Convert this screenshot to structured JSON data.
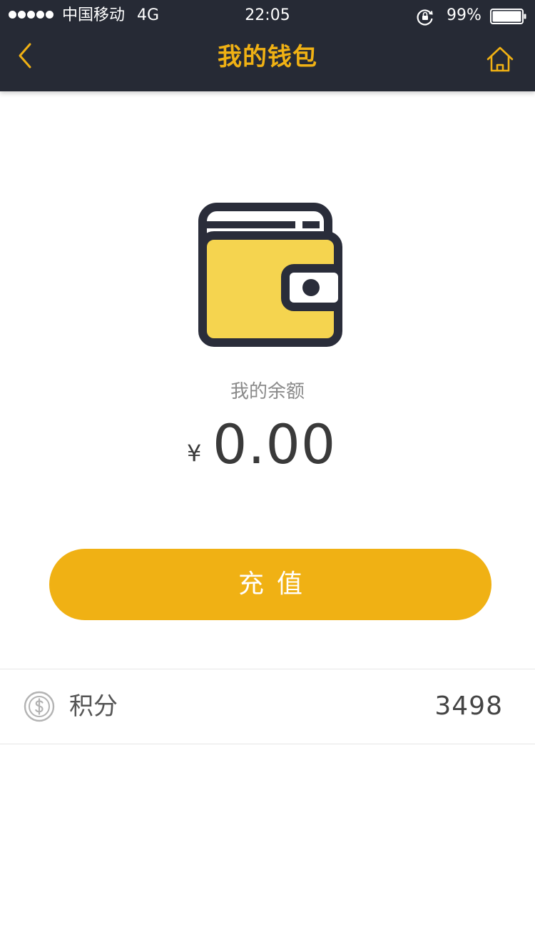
{
  "status_bar": {
    "carrier": "中国移动",
    "network": "4G",
    "time": "22:05",
    "battery": "99%"
  },
  "header": {
    "title": "我的钱包",
    "back_icon": "chevron-left-icon",
    "home_icon": "home-icon"
  },
  "wallet": {
    "illustration": "wallet-icon",
    "balance_label": "我的余额",
    "currency_symbol": "¥",
    "balance": "0.00"
  },
  "recharge_button": {
    "label": "充值"
  },
  "points": {
    "icon": "dollar-coin-icon",
    "label": "积分",
    "value": "3498"
  },
  "colors": {
    "header_bg": "#262a35",
    "accent": "#f0b114",
    "wallet_fill": "#f5d44f",
    "wallet_outline": "#2a2d3a"
  }
}
